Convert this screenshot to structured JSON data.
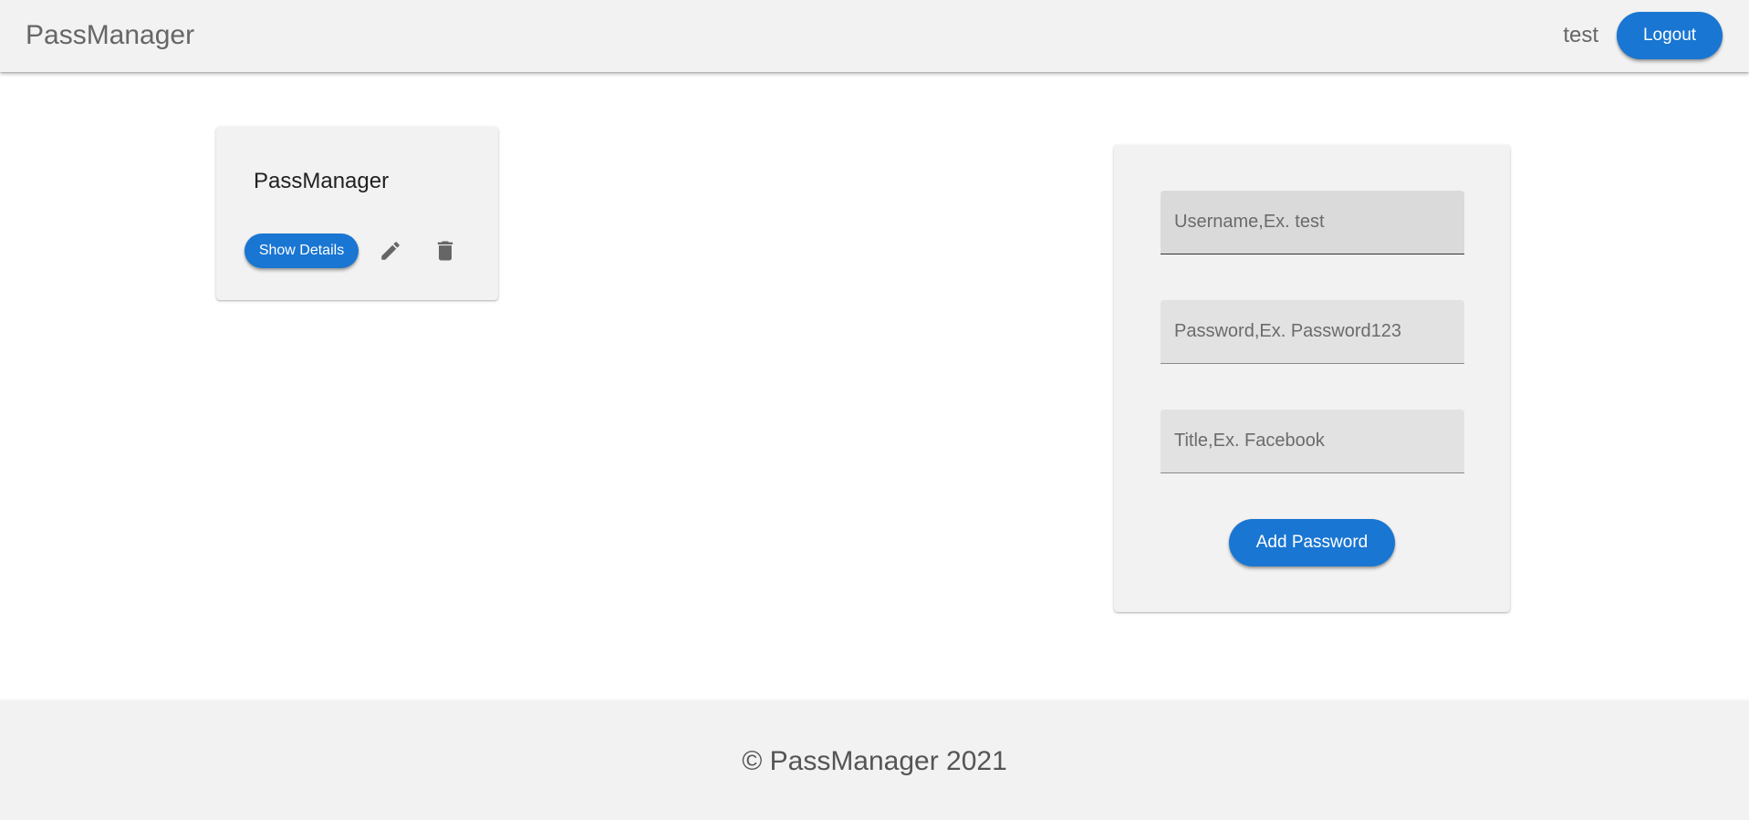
{
  "app": {
    "brand": "PassManager",
    "user": "test",
    "logout_label": "Logout",
    "accent_color": "#1976d2"
  },
  "passwords": [
    {
      "title": "PassManager",
      "show_details_label": "Show Details",
      "edit_icon": "pencil-icon",
      "delete_icon": "trash-icon"
    }
  ],
  "form": {
    "username_placeholder": "Username,Ex. test",
    "password_placeholder": "Password,Ex. Password123",
    "title_placeholder": "Title,Ex. Facebook",
    "username_value": "",
    "password_value": "",
    "title_value": "",
    "submit_label": "Add Password"
  },
  "footer": {
    "text": "© PassManager 2021"
  }
}
